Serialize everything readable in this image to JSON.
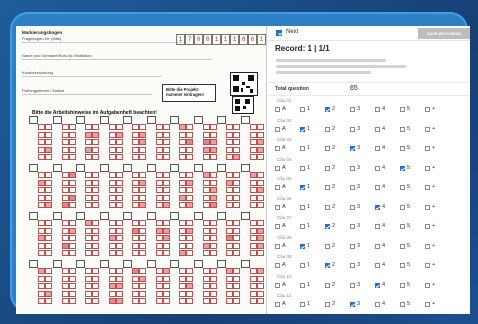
{
  "sheet": {
    "header_label_1": "Markierungsbogen",
    "header_label_2": "Fragebogen-Nr. (bitte)",
    "header_label_3": "Name und Vorname/Kurs-Nr./Institution",
    "header_label_4": "Kursbezeichnung",
    "header_label_5": "Prüfungstermin / Datum",
    "project_box_text": "Bitte die Projekt-nummer eintragen!",
    "instruction": "Bitte die Arbeitshinweise im Aufgabenheft beachten!",
    "digit_boxes": [
      "1",
      "7",
      "0",
      "8",
      "1",
      "1",
      "1",
      "8",
      "6",
      "1"
    ]
  },
  "panel": {
    "next_label": "Next",
    "next_checked": true,
    "save_button_label": "SAVE WITH READ",
    "record_title": "Record: 1 | 1/1",
    "total_question_label": "Total question",
    "total_question_value": "65",
    "questions": [
      {
        "title": "Câu 01",
        "checked": "2"
      },
      {
        "title": "Câu 02",
        "checked": "1"
      },
      {
        "title": "Câu 03",
        "checked": "3"
      },
      {
        "title": "Câu 04",
        "checked": "5"
      },
      {
        "title": "Câu 05",
        "checked": "1"
      },
      {
        "title": "Câu 06",
        "checked": "4"
      },
      {
        "title": "Câu 07",
        "checked": "2"
      },
      {
        "title": "Câu 08",
        "checked": "1"
      },
      {
        "title": "Câu 09",
        "checked": "2"
      },
      {
        "title": "Câu 10",
        "checked": "4"
      },
      {
        "title": "Câu 11",
        "checked": "3"
      }
    ],
    "option_labels": [
      "A",
      "1",
      "2",
      "3",
      "4",
      "5",
      "+"
    ]
  }
}
